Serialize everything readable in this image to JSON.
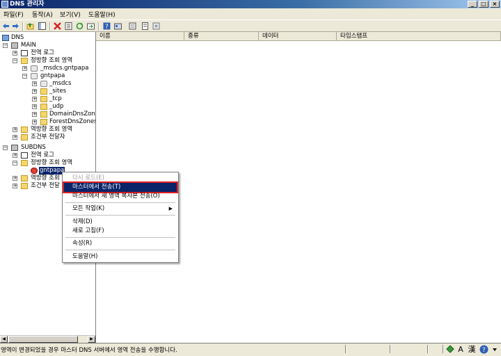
{
  "window": {
    "title": "DNS 관리자"
  },
  "window_buttons": [
    "_",
    "□",
    "×"
  ],
  "menu": [
    "파일(F)",
    "동작(A)",
    "보기(V)",
    "도움말(H)"
  ],
  "toolbar_icons": [
    "back-arrow-icon",
    "forward-arrow-icon",
    "up-folder-icon",
    "show-tree-icon",
    "delete-icon",
    "properties-icon",
    "refresh-icon",
    "export-icon",
    "help-icon",
    "action-icon",
    "new-record-icon",
    "list-icon",
    "update-icon"
  ],
  "tree": {
    "root": "DNS",
    "main_server": "MAIN",
    "global_log": "전역 로그",
    "forward_zones": "정방향 조회 영역",
    "zone_msdcs": "_msdcs.gntpapa",
    "zone_gntpapa": "gntpapa",
    "sub_msdcs": "_msdcs",
    "sub_sites": "_sites",
    "sub_tcp": "_tcp",
    "sub_udp": "_udp",
    "sub_domaindns": "DomainDnsZones",
    "sub_forestdns": "ForestDnsZones",
    "reverse_zones": "역방향 조회 영역",
    "conditional_forwarders": "조건부 전달자",
    "sub_server": "SUBDNS",
    "global_log2": "전역 로그",
    "forward_zones2": "정방향 조회 영역",
    "zone_gntpapa2": "gntpapa",
    "reverse_zones2": "역방향 조회",
    "conditional_forwarders2": "조건부 전달"
  },
  "columns": [
    "이름",
    "종류",
    "데이터",
    "타임스탬프"
  ],
  "context_menu": {
    "reload": "다시 로드(E)",
    "transfer_from_master": "마스터에서 전송(T)",
    "transfer_new_copy": "마스터에서 새 영역 복사본 전송(O)",
    "all_tasks": "모든 작업(K)",
    "delete": "삭제(D)",
    "refresh": "새로 고침(F)",
    "properties": "속성(R)",
    "help": "도움말(H)"
  },
  "status": {
    "text": "영역이 변경되었을 경우 마스터 DNS 서버에서 영역 전송을 수행합니다.",
    "ime_han": "A",
    "ime_hanja": "漢"
  },
  "colors": {
    "selection": "#0a246a",
    "highlight_outline": "#e02020",
    "title_bar": "#0a246a"
  }
}
